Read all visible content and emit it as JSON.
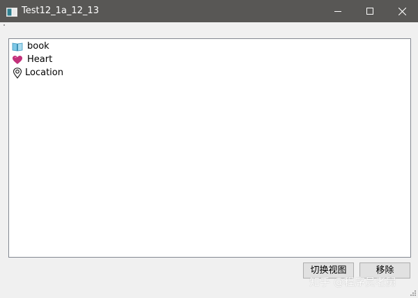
{
  "window": {
    "title": "Test12_1a_12_13"
  },
  "list": {
    "items": [
      {
        "label": "book",
        "icon": "book-icon"
      },
      {
        "label": "Heart",
        "icon": "heart-icon"
      },
      {
        "label": "Location",
        "icon": "location-pin-icon"
      }
    ]
  },
  "buttons": {
    "switch_view_label": "切换视图",
    "remove_label": "移除"
  },
  "watermark": {
    "text": "知乎 @程序员老舅"
  },
  "colors": {
    "titlebar": "#585755",
    "window_bg": "#f0f0f0",
    "list_bg": "#ffffff",
    "list_border": "#828790",
    "button_bg": "#e1e1e1",
    "button_border": "#adadad",
    "heart": "#c2307a",
    "book": "#5bb4d6"
  }
}
